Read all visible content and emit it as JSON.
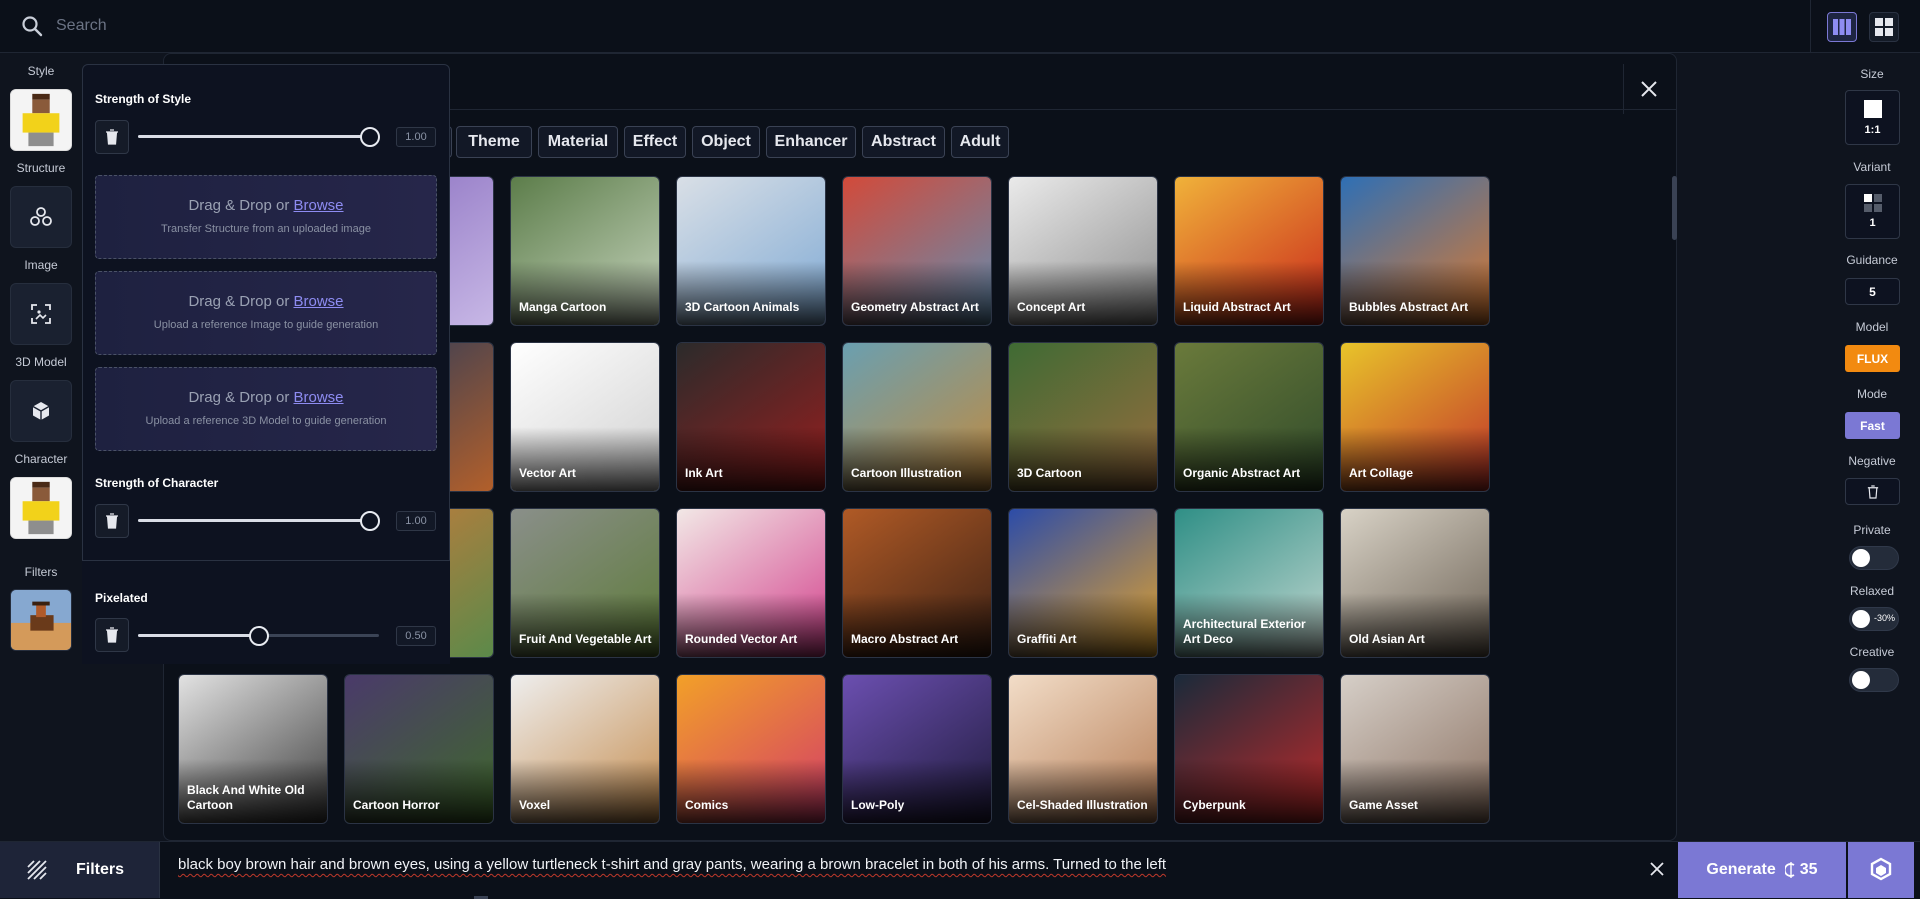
{
  "search": {
    "placeholder": "Search"
  },
  "left_rail": {
    "style_label": "Style",
    "structure_label": "Structure",
    "image_label": "Image",
    "model3d_label": "3D Model",
    "character_label": "Character",
    "filters_label": "Filters"
  },
  "popover": {
    "strength_style": {
      "title": "Strength of Style",
      "value": "1.00",
      "level": 1.0
    },
    "drops": [
      {
        "action": "Drag & Drop or ",
        "link": "Browse",
        "sub": "Transfer Structure from an uploaded image"
      },
      {
        "action": "Drag & Drop or ",
        "link": "Browse",
        "sub": "Upload a reference Image to guide generation"
      },
      {
        "action": "Drag & Drop or ",
        "link": "Browse",
        "sub": "Upload a reference 3D Model to guide generation"
      }
    ],
    "strength_character": {
      "title": "Strength of Character",
      "value": "1.00",
      "level": 1.0
    },
    "pixelated": {
      "title": "Pixelated",
      "value": "0.50",
      "level": 0.5
    }
  },
  "categories": [
    "Theme",
    "Material",
    "Effect",
    "Object",
    "Enhancer",
    "Abstract",
    "Adult"
  ],
  "styles": [
    {
      "label": "Manga Cartoon",
      "bg": [
        "#5c7d4a",
        "#c9d6c0"
      ]
    },
    {
      "label": "3D Cartoon Animals",
      "bg": [
        "#d9dfe6",
        "#7ea9d4"
      ]
    },
    {
      "label": "Geometry Abstract Art",
      "bg": [
        "#d24a3a",
        "#5e8fb4"
      ]
    },
    {
      "label": "Concept Art",
      "bg": [
        "#eaeaea",
        "#8b8b8b"
      ]
    },
    {
      "label": "Liquid Abstract Art",
      "bg": [
        "#f0b23a",
        "#c8241a"
      ]
    },
    {
      "label": "Bubbles Abstract Art",
      "bg": [
        "#2e6fb5",
        "#e07a2c"
      ]
    },
    {
      "label": "Vector Art",
      "bg": [
        "#ffffff",
        "#cfcfcf"
      ]
    },
    {
      "label": "Ink Art",
      "bg": [
        "#2b2b2b",
        "#9a1e1e"
      ]
    },
    {
      "label": "Cartoon Illustration",
      "bg": [
        "#6a9fb0",
        "#c48a3c"
      ]
    },
    {
      "label": "3D Cartoon",
      "bg": [
        "#3f6b34",
        "#9a6c3e"
      ]
    },
    {
      "label": "Organic Abstract Art",
      "bg": [
        "#6a7a3b",
        "#2f4a2a"
      ]
    },
    {
      "label": "Art Collage",
      "bg": [
        "#e8c42a",
        "#c0302a"
      ]
    },
    {
      "label": "Fruit And Vegetable Art",
      "bg": [
        "#8a8f8a",
        "#5c7a36"
      ]
    },
    {
      "label": "Rounded Vector Art",
      "bg": [
        "#f2e8e6",
        "#d23c8a"
      ]
    },
    {
      "label": "Macro Abstract Art",
      "bg": [
        "#b05a26",
        "#3a2014"
      ]
    },
    {
      "label": "Graffiti Art",
      "bg": [
        "#2c4ca8",
        "#e6a42a"
      ]
    },
    {
      "label": "Architectural Exterior Art Deco",
      "bg": [
        "#2f8f86",
        "#c6d9d2"
      ]
    },
    {
      "label": "Old Asian Art",
      "bg": [
        "#d8d2c6",
        "#6a5f52"
      ]
    },
    {
      "label": "Black And White Old Cartoon",
      "bg": [
        "#e2e2e2",
        "#3a3a3a"
      ]
    },
    {
      "label": "Cartoon Horror",
      "bg": [
        "#4a3a6a",
        "#3f6a2a"
      ]
    },
    {
      "label": "Voxel",
      "bg": [
        "#eeeeee",
        "#c48a4a"
      ]
    },
    {
      "label": "Comics",
      "bg": [
        "#f2a028",
        "#d23a6a"
      ]
    },
    {
      "label": "Low-Poly",
      "bg": [
        "#6b4fb0",
        "#1e1a3a"
      ]
    },
    {
      "label": "Cel-Shaded Illustration",
      "bg": [
        "#f2ddc8",
        "#b47a52"
      ]
    },
    {
      "label": "Cyberpunk",
      "bg": [
        "#1a2a3a",
        "#c02a2a"
      ]
    },
    {
      "label": "Game Asset",
      "bg": [
        "#d6cfc8",
        "#8a7060"
      ]
    }
  ],
  "partial_cards": [
    {
      "bg": [
        "#8a6fc0",
        "#c8b8e6"
      ]
    },
    {
      "bg": [
        "#2a3a5a",
        "#b4602a"
      ]
    },
    {
      "bg": [
        "#f4f4f4",
        "#c0c0c0"
      ]
    },
    {
      "bg": [
        "#c87a3a",
        "#5a8a4a"
      ]
    }
  ],
  "right_rail": {
    "size_label": "Size",
    "size_value": "1:1",
    "variant_label": "Variant",
    "variant_value": "1",
    "guidance_label": "Guidance",
    "guidance_value": "5",
    "model_label": "Model",
    "model_value": "FLUX",
    "mode_label": "Mode",
    "mode_value": "Fast",
    "negative_label": "Negative",
    "private_label": "Private",
    "relaxed_label": "Relaxed",
    "relaxed_tag": "-30%",
    "creative_label": "Creative"
  },
  "colors": {
    "accent": "#7b78d4",
    "model_orange": "#f28a10",
    "mode_purple": "#7b78d4"
  },
  "bottom": {
    "filters_label": "Filters",
    "prompt": "black boy brown hair and brown eyes, using a yellow turtleneck t-shirt and gray pants, wearing a brown bracelet in both of his arms. Turned to the left",
    "generate_label": "Generate",
    "generate_cost": "35"
  }
}
